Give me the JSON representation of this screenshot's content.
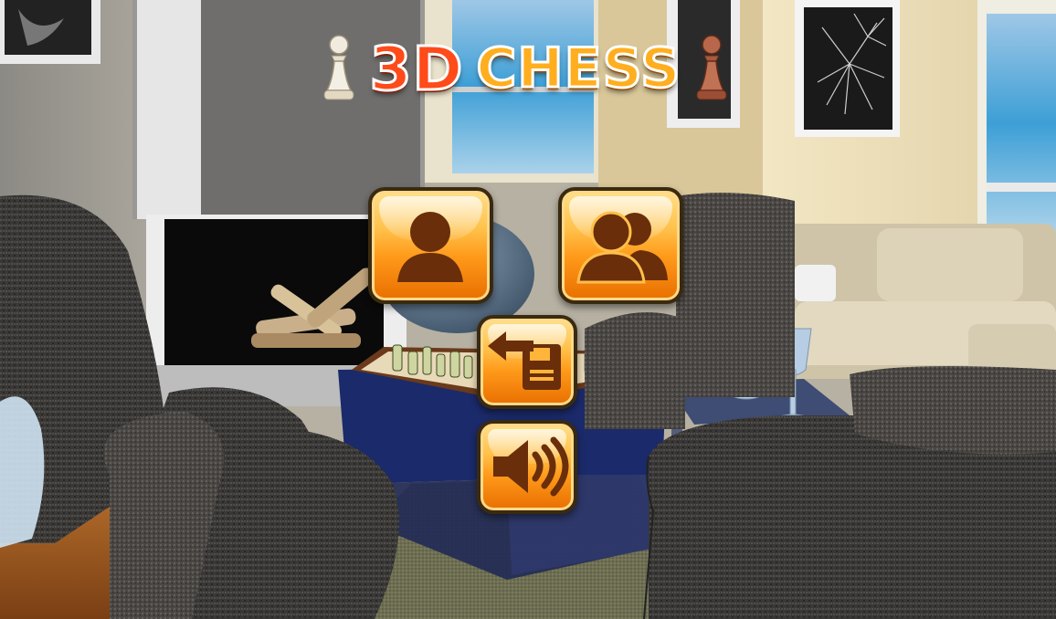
{
  "title": {
    "part1": "3D",
    "part2": "CHESS"
  },
  "menu": {
    "single_player_icon": "single-player-icon",
    "multiplayer_icon": "multiplayer-icon",
    "load_game_icon": "load-save-icon",
    "sound_icon": "speaker-icon"
  },
  "colors": {
    "button_top": "#ffe08a",
    "button_bottom": "#e86e00",
    "icon": "#6a2e0a",
    "title_3d": "#ff4a1a",
    "title_chess": "#ffae1f"
  }
}
